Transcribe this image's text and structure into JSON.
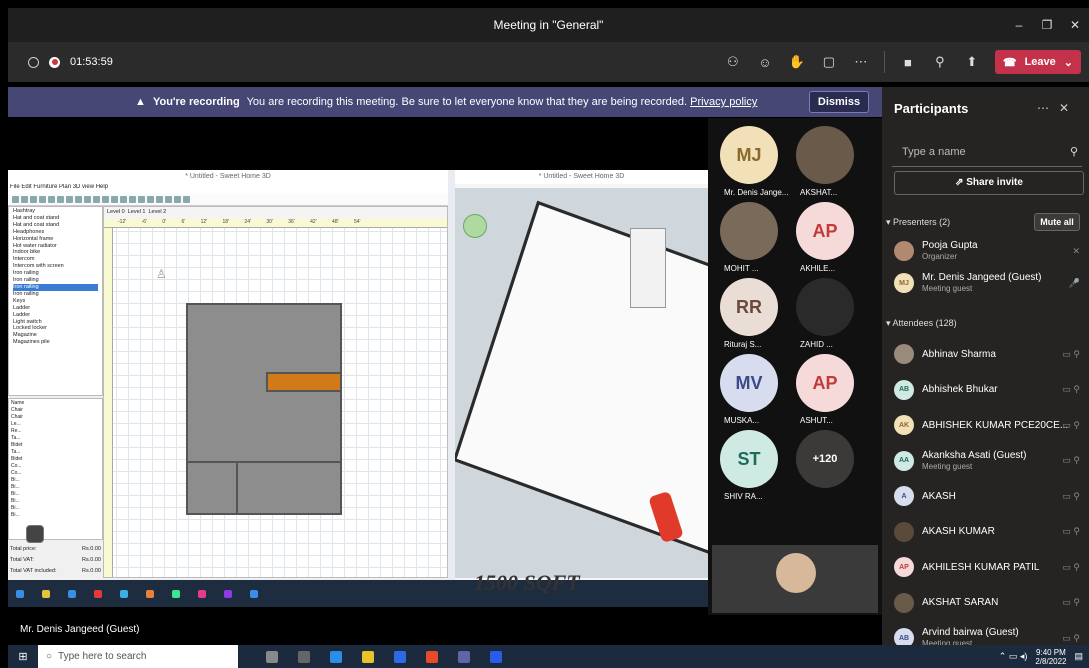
{
  "window": {
    "title": "Meeting in \"General\"",
    "controls": [
      "–",
      "❐",
      "✕"
    ]
  },
  "toolbar": {
    "timer": "01:53:59",
    "leave_label": "Leave"
  },
  "banner": {
    "heading": "You're recording",
    "message": "You are recording this meeting. Be sure to let everyone know that they are being recorded.",
    "link": "Privacy policy",
    "dismiss": "Dismiss"
  },
  "shared_screen": {
    "plan_title": "* Untitled - Sweet Home 3D",
    "view3d_title": "* Untitled - Sweet Home 3D",
    "menu": "File  Edit  Furniture  Plan  3D view  Help",
    "level_tabs": [
      "Level 0",
      "Level 1",
      "Level 2"
    ],
    "ruler": "-12' -6' 0' 6' 12' 18' 24' 30' 36' 42' 48' 54'",
    "catalog_items": [
      "Hashtray",
      "Hat and coat stand",
      "Hat and coat stand",
      "Headphones",
      "Horizontal frame",
      "Hot water radiator",
      "Indoor bike",
      "Intercom",
      "Intercom with screen",
      "Iron railing",
      "Iron railing",
      "Iron railing",
      "Iron railing",
      "Keys",
      "Ladder",
      "Ladder",
      "Light switch",
      "Locked locker",
      "Magazine",
      "Magazines pile"
    ],
    "catalog_selected_index": 11,
    "furniture_header": "Name",
    "furniture_rows": [
      "Chair",
      "Chair",
      "Le...",
      "Re...",
      "Ta...",
      "Bidet",
      "Ta...",
      "Bidet",
      "Co...",
      "Co...",
      "Bi...",
      "Bi...",
      "Bi...",
      "Bi...",
      "Bi...",
      "Bi..."
    ],
    "totals": {
      "price_label": "Total price:",
      "price": "Rs.0.00",
      "vat_label": "Total VAT:",
      "vat": "Rs.0.00",
      "incl_label": "Total VAT included:",
      "incl": "Rs.0.00"
    },
    "overlay_text": "1500 SQFT",
    "presenter_name": "Mr. Denis Jangeed (Guest)"
  },
  "gallery": [
    {
      "initials": "MJ",
      "name": "Mr. Denis Jange...",
      "bg": "#f1e0b8",
      "fg": "#8a6a2a",
      "photo": false
    },
    {
      "initials": "",
      "name": "AKSHAT...",
      "bg": "#6a5a4a",
      "fg": "#fff",
      "photo": true
    },
    {
      "initials": "",
      "name": "MOHIT ...",
      "bg": "#7a6a5a",
      "fg": "#fff",
      "photo": true
    },
    {
      "initials": "AP",
      "name": "AKHILE...",
      "bg": "#f6d9d9",
      "fg": "#c23a3a",
      "photo": false
    },
    {
      "initials": "RR",
      "name": "Rituraj S...",
      "bg": "#e9ddd6",
      "fg": "#6a4a3a",
      "photo": false
    },
    {
      "initials": "",
      "name": "ZAHID ...",
      "bg": "#2a2a2a",
      "fg": "#fff",
      "photo": true
    },
    {
      "initials": "MV",
      "name": "MUSKA...",
      "bg": "#d7dcef",
      "fg": "#3d4a88",
      "photo": false
    },
    {
      "initials": "AP",
      "name": "ASHUT...",
      "bg": "#f6d9d9",
      "fg": "#c23a3a",
      "photo": false
    },
    {
      "initials": "ST",
      "name": "SHIV RA...",
      "bg": "#cfe9e3",
      "fg": "#1e6b5a",
      "photo": false
    },
    {
      "initials": "+120",
      "name": "",
      "bg": "#3b3a39",
      "fg": "#fff",
      "photo": false
    }
  ],
  "participants": {
    "title": "Participants",
    "search_placeholder": "Type a name",
    "share_invite": "Share invite",
    "presenters_label": "Presenters (2)",
    "mute_all": "Mute all",
    "attendees_label": "Attendees (128)",
    "presenters": [
      {
        "name": "Pooja Gupta",
        "sub": "Organizer",
        "initials": "",
        "bg": "#b08a70",
        "fg": "#fff"
      },
      {
        "name": "Mr. Denis Jangeed (Guest)",
        "sub": "Meeting guest",
        "initials": "MJ",
        "bg": "#f1e0b8",
        "fg": "#8a6a2a"
      }
    ],
    "attendees": [
      {
        "name": "Abhinav Sharma",
        "sub": "",
        "initials": "",
        "bg": "#9a8a7a",
        "fg": "#fff"
      },
      {
        "name": "Abhishek Bhukar",
        "sub": "",
        "initials": "AB",
        "bg": "#cfe9e3",
        "fg": "#1e6b5a"
      },
      {
        "name": "ABHISHEK KUMAR PCE20CE...",
        "sub": "",
        "initials": "AK",
        "bg": "#f1e0b8",
        "fg": "#8a6a2a"
      },
      {
        "name": "Akanksha Asati (Guest)",
        "sub": "Meeting guest",
        "initials": "AA",
        "bg": "#cfe9e3",
        "fg": "#1e6b5a"
      },
      {
        "name": "AKASH",
        "sub": "",
        "initials": "A",
        "bg": "#d7dcef",
        "fg": "#3d4a88"
      },
      {
        "name": "AKASH KUMAR",
        "sub": "",
        "initials": "",
        "bg": "#5a4a3a",
        "fg": "#fff"
      },
      {
        "name": "AKHILESH KUMAR PATIL",
        "sub": "",
        "initials": "AP",
        "bg": "#f6d9d9",
        "fg": "#c23a3a"
      },
      {
        "name": "AKSHAT SARAN",
        "sub": "",
        "initials": "",
        "bg": "#6a5a4a",
        "fg": "#fff"
      },
      {
        "name": "Arvind bairwa (Guest)",
        "sub": "Meeting guest",
        "initials": "AB",
        "bg": "#d7dcef",
        "fg": "#3d4a88"
      }
    ]
  },
  "taskbar": {
    "search_placeholder": "Type here to search",
    "time": "9:40 PM",
    "date": "2/8/2022"
  }
}
